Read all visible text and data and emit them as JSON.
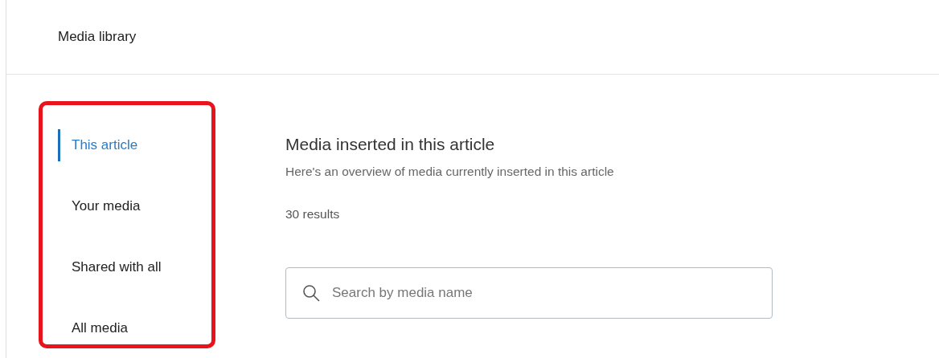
{
  "header": {
    "title": "Media library"
  },
  "sidebar": {
    "highlighted": true,
    "items": [
      {
        "label": "This article",
        "selected": true
      },
      {
        "label": "Your media",
        "selected": false
      },
      {
        "label": "Shared with all",
        "selected": false
      },
      {
        "label": "All media",
        "selected": false
      }
    ]
  },
  "main": {
    "heading": "Media inserted in this article",
    "subtitle": "Here's an overview of media currently inserted in this article",
    "results": "30 results",
    "search": {
      "placeholder": "Search by media name"
    }
  }
}
